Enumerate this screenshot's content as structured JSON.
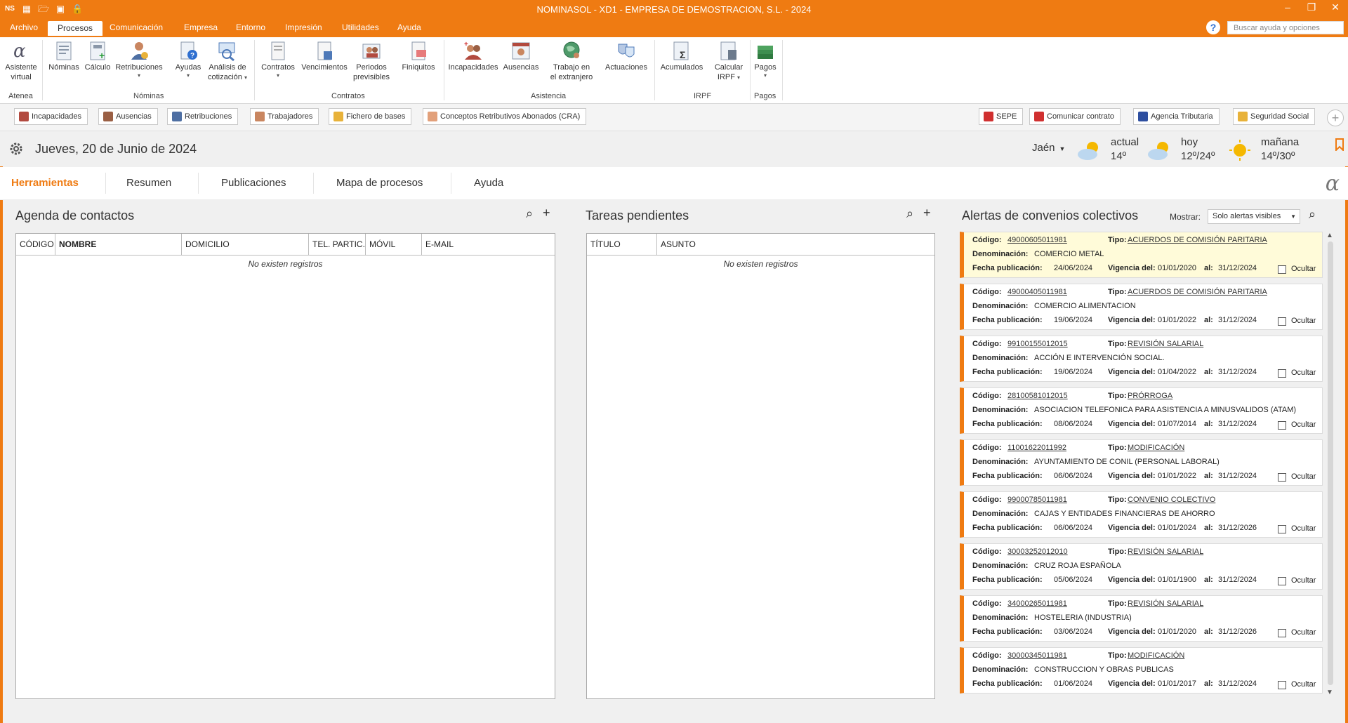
{
  "window": {
    "title": "NOMINASOL - XD1 - EMPRESA DE DEMOSTRACION, S.L. - 2024",
    "app_badge": "NS"
  },
  "ribbon_tabs": [
    "Archivo",
    "Procesos",
    "Comunicación",
    "Empresa",
    "Entorno",
    "Impresión",
    "Utilidades",
    "Ayuda"
  ],
  "active_ribbon_tab": "Procesos",
  "search": {
    "placeholder": "Buscar ayuda y opciones"
  },
  "ribbon": {
    "buttons": {
      "asistente": "Asistente\nvirtual",
      "nominas": "Nóminas",
      "calculo": "Cálculo",
      "retribuciones": "Retribuciones",
      "ayudas": "Ayudas",
      "analisis": "Análisis de\ncotización",
      "contratos": "Contratos",
      "vencimientos": "Vencimientos",
      "periodos": "Periodos\nprevisibles",
      "finiquitos": "Finiquitos",
      "incapacidades": "Incapacidades",
      "ausencias": "Ausencias",
      "trabajo": "Trabajo en\nel extranjero",
      "actuaciones": "Actuaciones",
      "acumulados": "Acumulados",
      "calcular_irpf": "Calcular\nIRPF",
      "pagos": "Pagos"
    },
    "groups": {
      "atenea": "Atenea",
      "nominas": "Nóminas",
      "contratos": "Contratos",
      "asistencia": "Asistencia",
      "irpf": "IRPF",
      "pagos": "Pagos"
    }
  },
  "quickbar": {
    "left": [
      "Incapacidades",
      "Ausencias",
      "Retribuciones",
      "Trabajadores",
      "Fichero de bases",
      "Conceptos Retributivos Abonados (CRA)"
    ],
    "right": [
      "SEPE",
      "Comunicar contrato",
      "Agencia Tributaria",
      "Seguridad Social"
    ]
  },
  "header": {
    "date": "Jueves, 20 de Junio de 2024",
    "city": "Jaén",
    "weather": {
      "actual": {
        "label": "actual",
        "temp": "14º"
      },
      "hoy": {
        "label": "hoy",
        "temp": "12º/24º"
      },
      "manana": {
        "label": "mañana",
        "temp": "14º/30º"
      }
    }
  },
  "nav_tabs": [
    "Herramientas",
    "Resumen",
    "Publicaciones",
    "Mapa de procesos",
    "Ayuda"
  ],
  "active_nav_tab": "Herramientas",
  "agenda": {
    "title": "Agenda de contactos",
    "columns": [
      "CÓDIGO",
      "NOMBRE",
      "DOMICILIO",
      "TEL. PARTIC...",
      "MÓVIL",
      "E-MAIL"
    ],
    "empty": "No existen registros"
  },
  "tareas": {
    "title": "Tareas pendientes",
    "columns": [
      "TÍTULO",
      "ASUNTO"
    ],
    "empty": "No existen registros"
  },
  "alertas": {
    "title": "Alertas de convenios colectivos",
    "mostrar_label": "Mostrar:",
    "mostrar_value": "Solo alertas visibles",
    "labels": {
      "codigo": "Código:",
      "tipo": "Tipo:",
      "denominacion": "Denominación:",
      "fecha": "Fecha publicación:",
      "vigencia": "Vigencia del:",
      "al": "al:",
      "ocultar": "Ocultar"
    },
    "items": [
      {
        "codigo": "49000605011981",
        "tipo": "ACUERDOS DE COMISIÓN PARITARIA",
        "denominacion": "COMERCIO METAL",
        "fecha": "24/06/2024",
        "desde": "01/01/2020",
        "hasta": "31/12/2024"
      },
      {
        "codigo": "49000405011981",
        "tipo": "ACUERDOS DE COMISIÓN PARITARIA",
        "denominacion": "COMERCIO ALIMENTACION",
        "fecha": "19/06/2024",
        "desde": "01/01/2022",
        "hasta": "31/12/2024"
      },
      {
        "codigo": "99100155012015",
        "tipo": "REVISIÓN SALARIAL",
        "denominacion": "ACCIÓN E INTERVENCIÓN SOCIAL.",
        "fecha": "19/06/2024",
        "desde": "01/04/2022",
        "hasta": "31/12/2024"
      },
      {
        "codigo": "28100581012015",
        "tipo": "PRÓRROGA",
        "denominacion": "ASOCIACION TELEFONICA PARA ASISTENCIA A MINUSVALIDOS (ATAM)",
        "fecha": "08/06/2024",
        "desde": "01/07/2014",
        "hasta": "31/12/2024"
      },
      {
        "codigo": "11001622011992",
        "tipo": "MODIFICACIÓN",
        "denominacion": "AYUNTAMIENTO DE CONIL (PERSONAL LABORAL)",
        "fecha": "06/06/2024",
        "desde": "01/01/2022",
        "hasta": "31/12/2024"
      },
      {
        "codigo": "99000785011981",
        "tipo": "CONVENIO COLECTIVO",
        "denominacion": "CAJAS Y ENTIDADES FINANCIERAS DE AHORRO",
        "fecha": "06/06/2024",
        "desde": "01/01/2024",
        "hasta": "31/12/2026"
      },
      {
        "codigo": "30003252012010",
        "tipo": "REVISIÓN SALARIAL",
        "denominacion": "CRUZ ROJA ESPAÑOLA",
        "fecha": "05/06/2024",
        "desde": "01/01/1900",
        "hasta": "31/12/2024"
      },
      {
        "codigo": "34000265011981",
        "tipo": "REVISIÓN SALARIAL",
        "denominacion": "HOSTELERIA (INDUSTRIA)",
        "fecha": "03/06/2024",
        "desde": "01/01/2020",
        "hasta": "31/12/2026"
      },
      {
        "codigo": "30000345011981",
        "tipo": "MODIFICACIÓN",
        "denominacion": "CONSTRUCCION Y OBRAS PUBLICAS",
        "fecha": "01/06/2024",
        "desde": "01/01/2017",
        "hasta": "31/12/2024"
      }
    ]
  },
  "colors": {
    "accent": "#ef7b12",
    "highlight": "#fffbd9"
  }
}
